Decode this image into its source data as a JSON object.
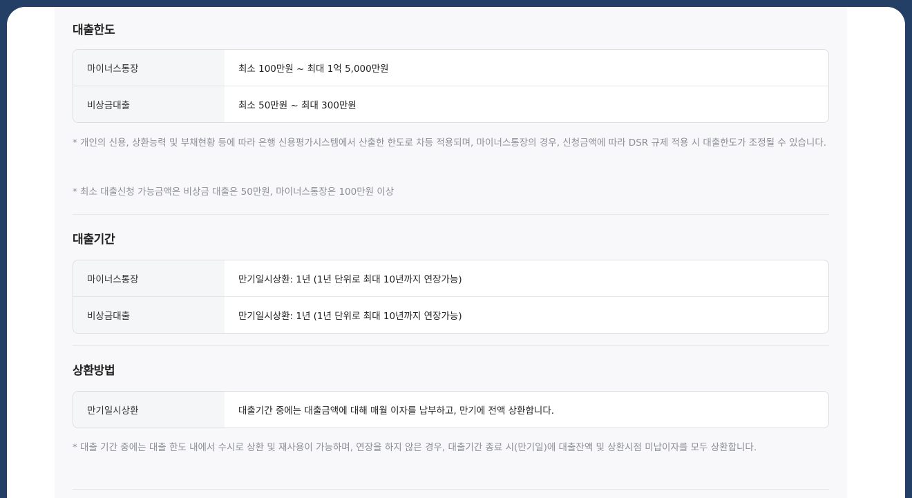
{
  "limit": {
    "title": "대출한도",
    "rows": [
      {
        "label": "마이너스통장",
        "value": "최소 100만원 ~ 최대 1억 5,000만원"
      },
      {
        "label": "비상금대출",
        "value": "최소 50만원 ~ 최대 300만원"
      }
    ],
    "notes": [
      "* 개인의 신용, 상환능력 및 부채현황 등에 따라 은행 신용평가시스템에서 산출한 한도로 차등 적용되며, 마이너스통장의 경우, 신청금액에 따라 DSR 규제 적용 시 대출한도가 조정될 수 있습니다.",
      "* 최소 대출신청 가능금액은 비상금 대출은 50만원, 마이너스통장은 100만원 이상"
    ]
  },
  "period": {
    "title": "대출기간",
    "rows": [
      {
        "label": "마이너스통장",
        "value": "만기일시상환: 1년 (1년 단위로 최대 10년까지 연장가능)"
      },
      {
        "label": "비상금대출",
        "value": "만기일시상환: 1년 (1년 단위로 최대 10년까지 연장가능)"
      }
    ]
  },
  "repayment": {
    "title": "상환방법",
    "rows": [
      {
        "label": "만기일시상환",
        "value": "대출기간 중에는 대출금액에 대해 매월 이자를 납부하고, 만기에 전액 상환합니다."
      }
    ],
    "notes": [
      "* 대출 기간 중에는 대출 한도 내에서 수시로 상환 및 재사용이 가능하며, 연장을 하지 않은 경우, 대출기간 종료 시(만기일)에 대출잔액 및 상환시점 미납이자를 모두 상환합니다."
    ]
  }
}
